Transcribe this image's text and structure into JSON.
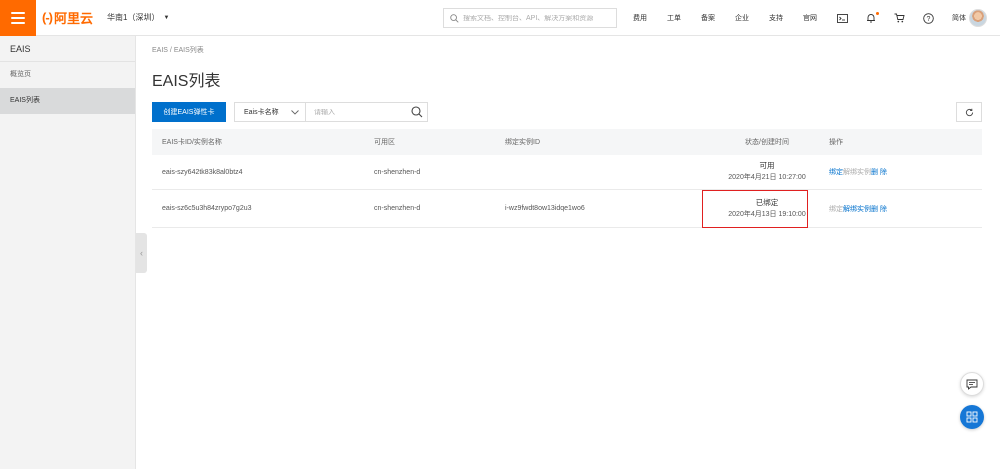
{
  "header": {
    "logo_mark": "(-)",
    "logo_text": "阿里云",
    "region": "华南1（深圳）",
    "search_placeholder": "搜索文档、控制台、API、解决方案和资源",
    "nav": [
      "费用",
      "工单",
      "备案",
      "企业",
      "支持",
      "官网"
    ],
    "lang": "简体",
    "colors": {
      "brand": "#ff6a00",
      "primary": "#0070cc"
    }
  },
  "sidebar": {
    "title": "EAIS",
    "items": [
      {
        "label": "概览页"
      },
      {
        "label": "EAIS列表"
      }
    ]
  },
  "main": {
    "breadcrumb": [
      "EAIS",
      "/",
      "EAIS列表"
    ],
    "title": "EAIS列表",
    "toolbar": {
      "create_label": "创建EAIS弹性卡",
      "filter_label": "Eais卡名称",
      "filter_placeholder": "请输入"
    },
    "table": {
      "columns": [
        "EAIS卡ID/实例名称",
        "可用区",
        "绑定实例ID",
        "状态/创建时间",
        "操作"
      ],
      "rows": [
        {
          "id": "eais-szy642tk83k8al0btz4",
          "zone": "cn-shenzhen-d",
          "instance": "",
          "status": "可用",
          "time": "2020年4月21日 10:27:00",
          "ops": [
            {
              "label": "绑定",
              "enabled": true
            },
            {
              "label": "解绑实例",
              "enabled": false
            },
            {
              "label": "删 除",
              "enabled": true
            }
          ]
        },
        {
          "id": "eais-sz6c5u3h84zrypo7g2u3",
          "zone": "cn-shenzhen-d",
          "instance": "i-wz9fwdt8ow13idqe1wo6",
          "status": "已绑定",
          "time": "2020年4月13日 19:10:00",
          "ops": [
            {
              "label": "绑定",
              "enabled": false
            },
            {
              "label": "解绑实例",
              "enabled": true
            },
            {
              "label": "删 除",
              "enabled": true
            }
          ]
        }
      ]
    }
  },
  "icons": [
    "menu-icon",
    "search-icon",
    "terminal-icon",
    "bell-icon",
    "cart-icon",
    "help-icon",
    "refresh-icon",
    "chevron-down-icon",
    "chevron-left-icon",
    "chat-icon",
    "apps-icon"
  ]
}
